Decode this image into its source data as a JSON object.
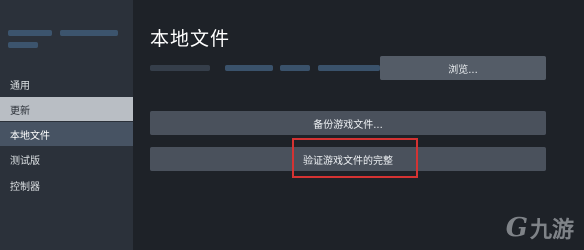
{
  "sidebar": {
    "items": [
      {
        "label": "通用",
        "state": "normal"
      },
      {
        "label": "更新",
        "state": "hover"
      },
      {
        "label": "本地文件",
        "state": "active"
      },
      {
        "label": "测试版",
        "state": "normal"
      },
      {
        "label": "控制器",
        "state": "normal"
      }
    ]
  },
  "main": {
    "title": "本地文件",
    "browse_label": "浏览...",
    "backup_label": "备份游戏文件...",
    "verify_label": "验证游戏文件的完整"
  },
  "watermark": {
    "logo": "G",
    "text": "九游"
  },
  "colors": {
    "highlight_border": "#d43333",
    "active_nav": "#475363"
  }
}
